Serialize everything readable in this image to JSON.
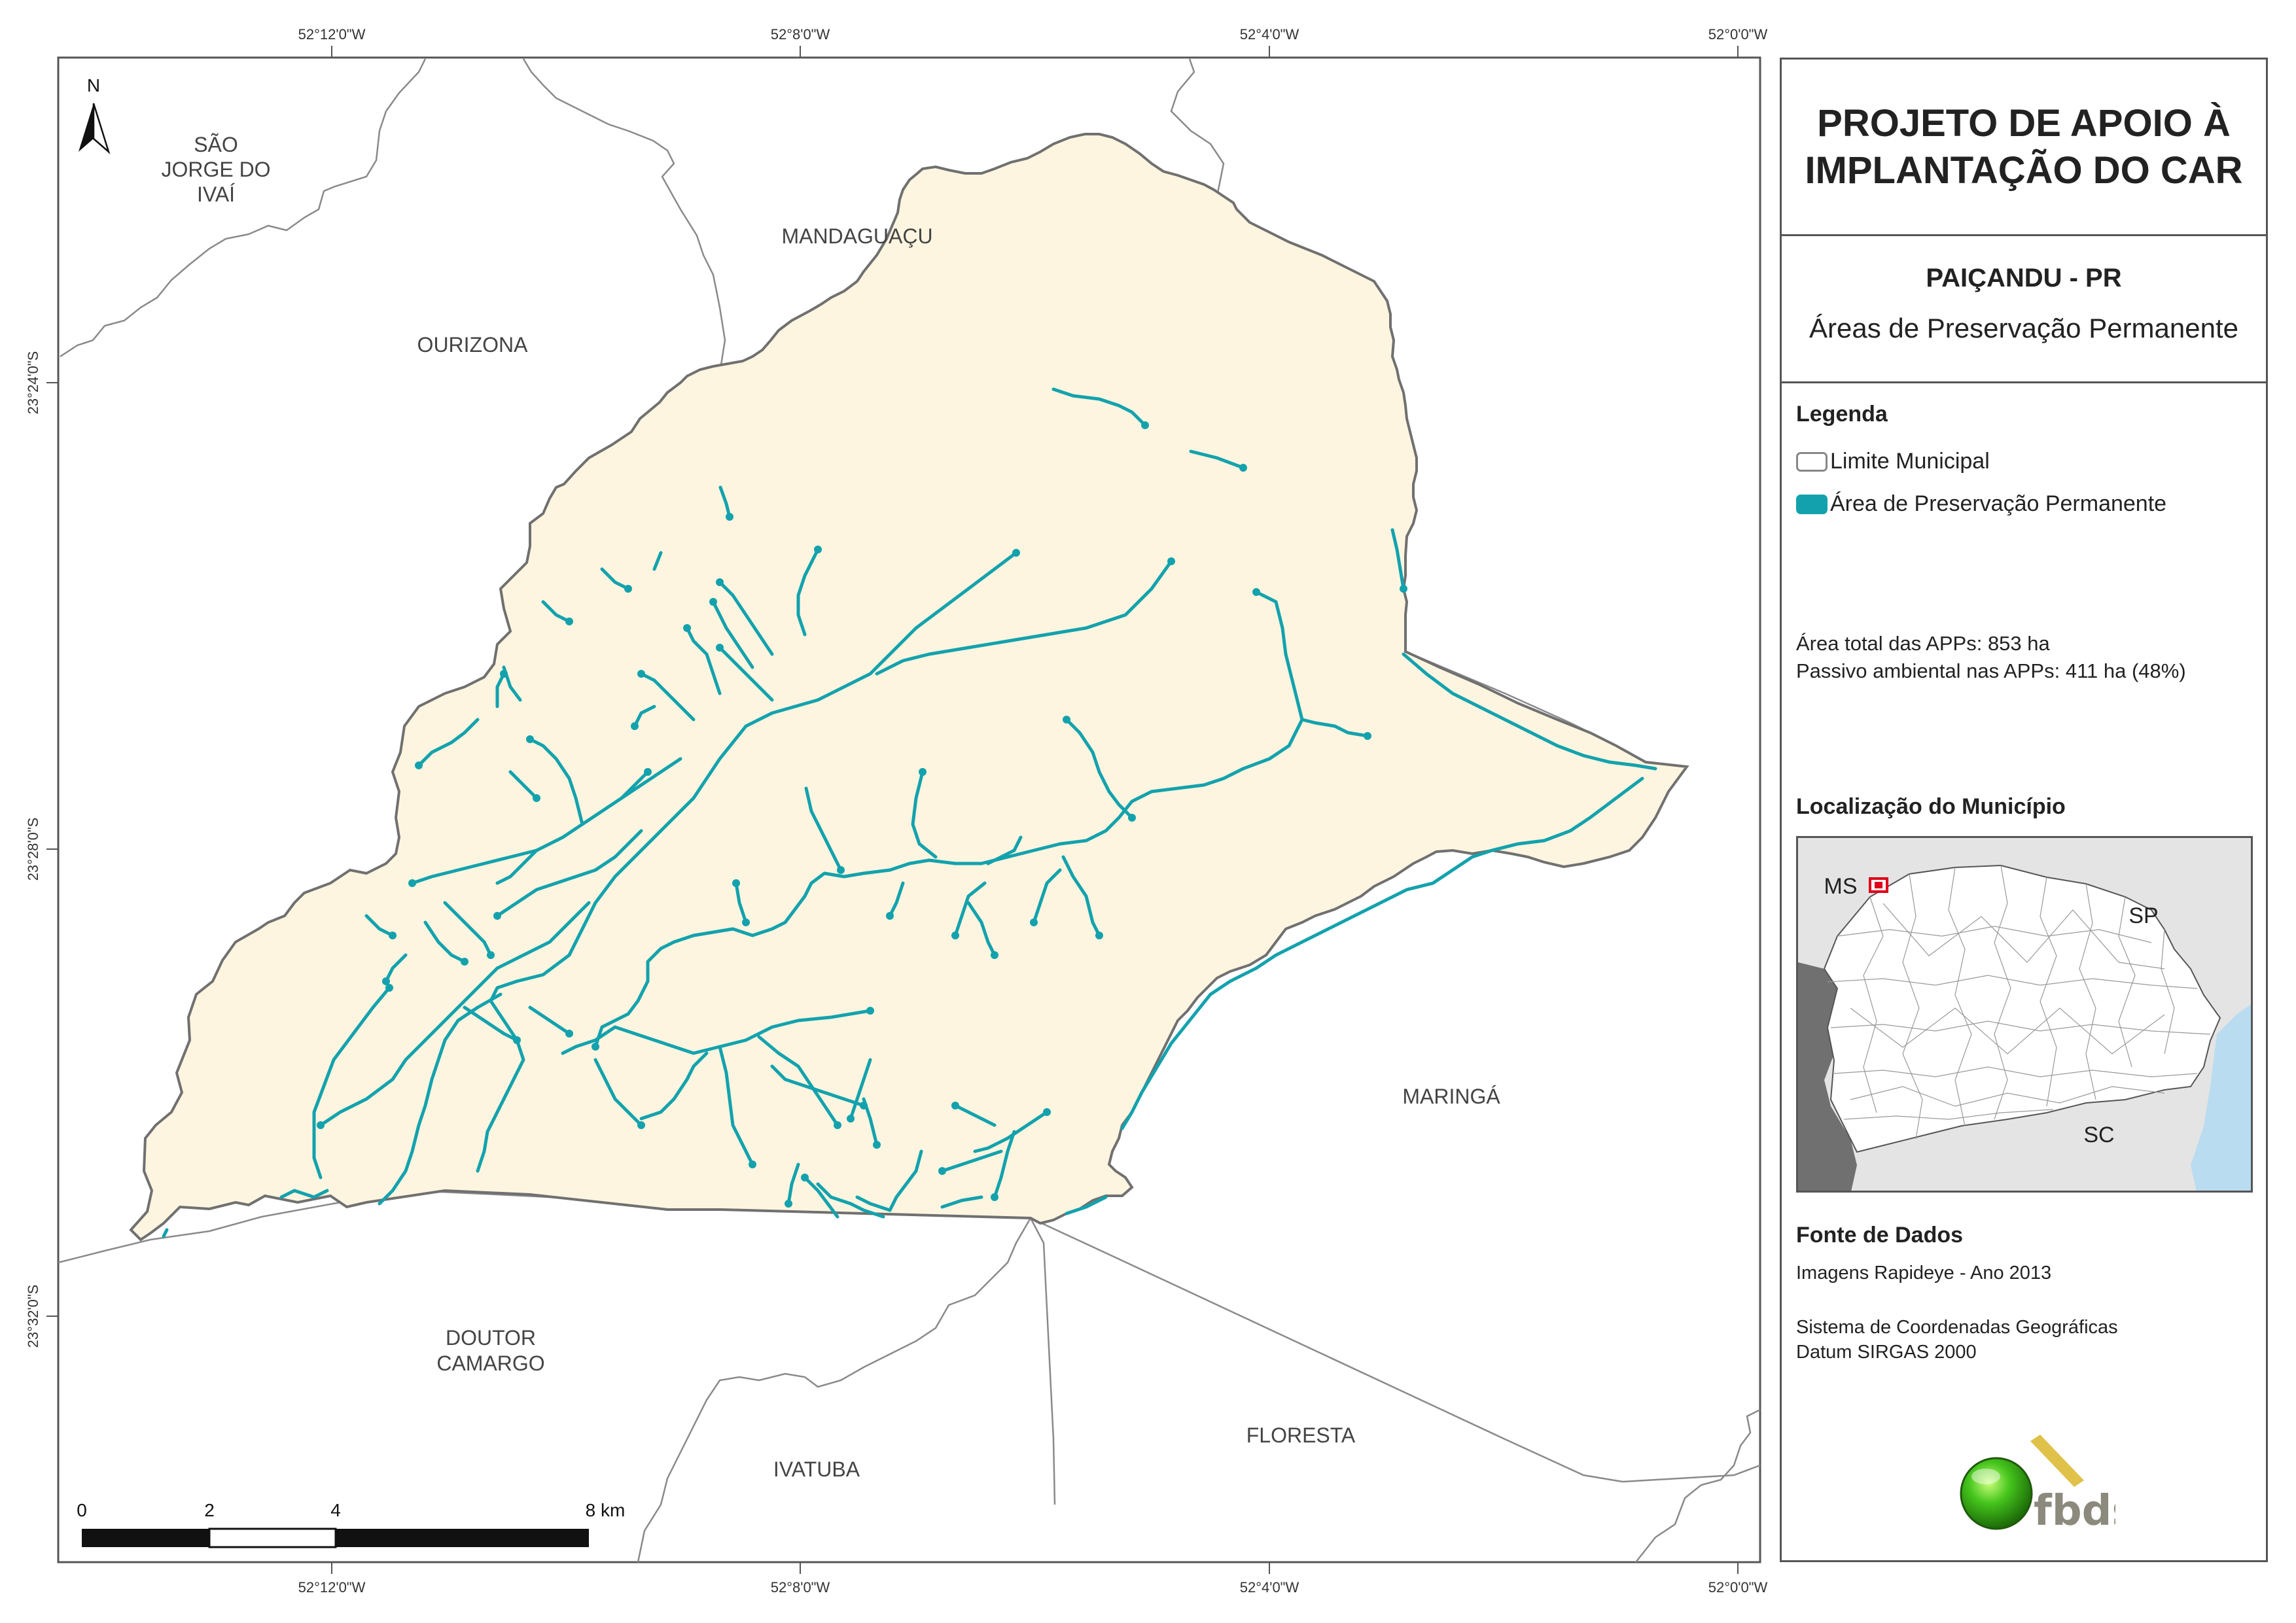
{
  "coords": {
    "lon": [
      "52°12'0\"W",
      "52°8'0\"W",
      "52°4'0\"W",
      "52°0'0\"W"
    ],
    "lat": [
      "23°24'0\"S",
      "23°28'0\"S",
      "23°32'0\"S"
    ]
  },
  "north_arrow": {
    "label": "N"
  },
  "municipalities": {
    "sao_jorge": [
      "SÃO",
      "JORGE DO",
      "IVAÍ"
    ],
    "ourizona": "OURIZONA",
    "mandaguacu": "MANDAGUAÇU",
    "maringa": "MARINGÁ",
    "doutor_camargo": [
      "DOUTOR",
      "CAMARGO"
    ],
    "ivatuba": "IVATUBA",
    "floresta": "FLORESTA"
  },
  "scale_bar": {
    "labels": [
      "0",
      "2",
      "4",
      "8 km"
    ]
  },
  "panel": {
    "title": [
      "PROJETO DE APOIO À",
      "IMPLANTAÇÃO DO CAR"
    ],
    "municipality": "PAIÇANDU - PR",
    "theme": "Áreas de Preservação Permanente",
    "legend": {
      "heading": "Legenda",
      "items": [
        {
          "label": "Limite Municipal",
          "color": "#ffffff"
        },
        {
          "label": "Área de Preservação Permanente",
          "color": "#13a2ad"
        }
      ]
    },
    "stats": [
      "Área total das APPs: 853 ha",
      "Passivo ambiental nas APPs: 411 ha (48%)"
    ],
    "location": {
      "heading": "Localização do Município",
      "labels": {
        "ms": "MS",
        "sp": "SP",
        "sc": "SC"
      }
    },
    "sources": {
      "heading": "Fonte de Dados",
      "lines": [
        "Imagens Rapideye - Ano 2013",
        "Sistema de Coordenadas Geográficas",
        "Datum SIRGAS 2000"
      ]
    },
    "logo_text": "fbds"
  },
  "colors": {
    "municipality_fill": "#fdf5e0",
    "app_stream": "#13a2ad",
    "boundary": "#777777",
    "state_gray": "#e4e4e4",
    "neighbor_dark": "#707070",
    "sea": "#b9dcf0",
    "highlight": "#e0001a"
  }
}
